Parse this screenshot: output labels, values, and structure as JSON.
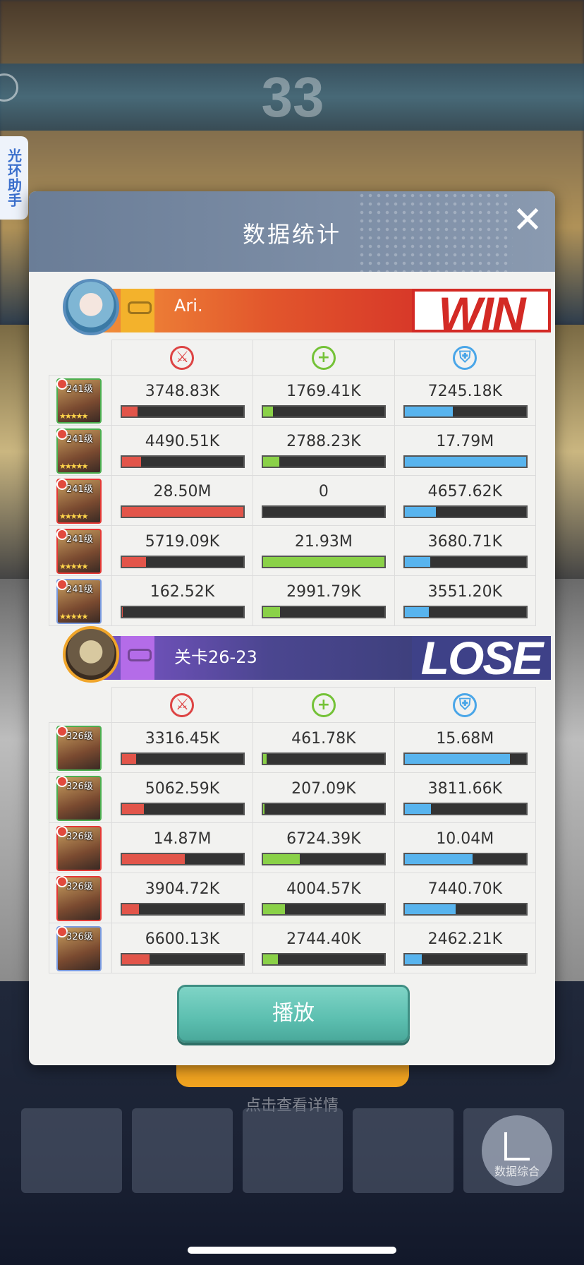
{
  "background": {
    "score": "33",
    "hint_text": "点击查看详情",
    "stats_button_label": "数据综合"
  },
  "helper_tab": {
    "label": "光环助手"
  },
  "modal": {
    "title": "数据统计",
    "close_icon": "close-icon",
    "play_button_label": "播放"
  },
  "columns": [
    {
      "icon": "attack-icon",
      "meaning": "damage",
      "color": "#dd4444"
    },
    {
      "icon": "heal-icon",
      "meaning": "heal",
      "color": "#74c237"
    },
    {
      "icon": "shield-icon",
      "meaning": "shield",
      "color": "#4aa6e8"
    }
  ],
  "teams": [
    {
      "name": "Ari.",
      "result": "WIN",
      "heroes": [
        {
          "level": "241级",
          "damage": "3748.83K",
          "damage_pct": 13,
          "heal": "1769.41K",
          "heal_pct": 8,
          "shield": "7245.18K",
          "shield_pct": 40
        },
        {
          "level": "241级",
          "damage": "4490.51K",
          "damage_pct": 16,
          "heal": "2788.23K",
          "heal_pct": 13,
          "shield": "17.79M",
          "shield_pct": 100
        },
        {
          "level": "241级",
          "damage": "28.50M",
          "damage_pct": 100,
          "heal": "0",
          "heal_pct": 0,
          "shield": "4657.62K",
          "shield_pct": 26
        },
        {
          "level": "241级",
          "damage": "5719.09K",
          "damage_pct": 20,
          "heal": "21.93M",
          "heal_pct": 100,
          "shield": "3680.71K",
          "shield_pct": 21
        },
        {
          "level": "241级",
          "damage": "162.52K",
          "damage_pct": 1,
          "heal": "2991.79K",
          "heal_pct": 14,
          "shield": "3551.20K",
          "shield_pct": 20
        }
      ]
    },
    {
      "name": "关卡26-23",
      "result": "LOSE",
      "heroes": [
        {
          "level": "326级",
          "damage": "3316.45K",
          "damage_pct": 12,
          "heal": "461.78K",
          "heal_pct": 3,
          "shield": "15.68M",
          "shield_pct": 87
        },
        {
          "level": "326级",
          "damage": "5062.59K",
          "damage_pct": 18,
          "heal": "207.09K",
          "heal_pct": 1,
          "shield": "3811.66K",
          "shield_pct": 22
        },
        {
          "level": "326级",
          "damage": "14.87M",
          "damage_pct": 52,
          "heal": "6724.39K",
          "heal_pct": 30,
          "shield": "10.04M",
          "shield_pct": 56
        },
        {
          "level": "326级",
          "damage": "3904.72K",
          "damage_pct": 14,
          "heal": "4004.57K",
          "heal_pct": 18,
          "shield": "7440.70K",
          "shield_pct": 42
        },
        {
          "level": "326级",
          "damage": "6600.13K",
          "damage_pct": 23,
          "heal": "2744.40K",
          "heal_pct": 12,
          "shield": "2462.21K",
          "shield_pct": 14
        }
      ]
    }
  ]
}
